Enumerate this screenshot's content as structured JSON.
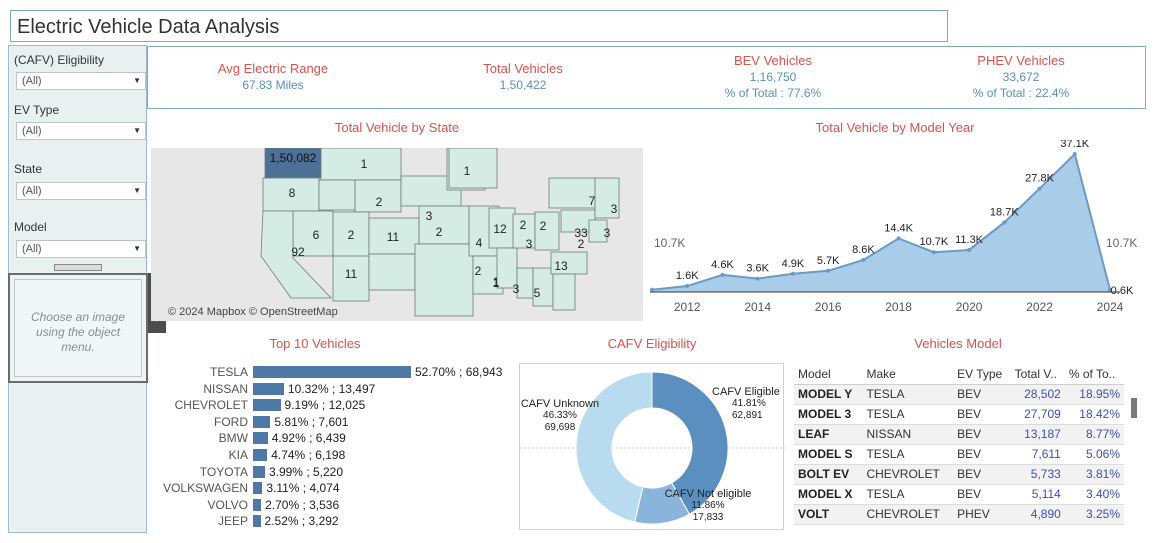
{
  "title": "Electric Vehicle Data Analysis",
  "filters": [
    {
      "label": "(CAFV) Eligibility",
      "value": "(All)"
    },
    {
      "label": "EV Type",
      "value": "(All)"
    },
    {
      "label": "State",
      "value": "(All)"
    },
    {
      "label": "Model",
      "value": "(All)"
    }
  ],
  "image_panel": {
    "message_line1": "Choose an image",
    "message_line2": "using the object",
    "message_line3": "menu."
  },
  "toolbar_icons": [
    "close-icon",
    "pin-icon",
    "caret-down-icon"
  ],
  "kpis": {
    "avg_range": {
      "title": "Avg Electric Range",
      "value": "67.83 Miles"
    },
    "total": {
      "title": "Total Vehicles",
      "value": "1,50,422"
    },
    "bev": {
      "title": "BEV Vehicles",
      "value": "1,16,750",
      "pct": "% of Total : 77.6%"
    },
    "phev": {
      "title": "PHEV Vehicles",
      "value": "33,672",
      "pct": "% of Total : 22.4%"
    }
  },
  "sections": {
    "map_title": "Total Vehicle by State",
    "year_title": "Total Vehicle by Model Year",
    "top10_title": "Top 10  Vehicles",
    "cafv_title": "CAFV Eligibility",
    "models_title": "Vehicles Model"
  },
  "map": {
    "credit": "© 2024 Mapbox © OpenStreetMap",
    "labels": [
      "1,50,082",
      "1",
      "8",
      "2",
      "1",
      "6",
      "92",
      "2",
      "11",
      "3",
      "2",
      "12",
      "2",
      "4",
      "3",
      "2",
      "7",
      "3",
      "33",
      "2",
      "1",
      "11",
      "2",
      "13",
      "3",
      "1",
      "3",
      "5"
    ]
  },
  "colors": {
    "accent_red": "#d9534f",
    "bar_blue": "#4e79a7",
    "area_blue": "#a9cde8",
    "line_blue": "#6b9ac4",
    "donut_dark": "#5b8fc0",
    "donut_mid": "#8ab4d9",
    "donut_light": "#b8dbf0",
    "map_fill": "#d4ece4",
    "map_wa": "#4e6f96"
  },
  "chart_data": [
    {
      "type": "area",
      "title": "Total Vehicle by Model Year",
      "x": [
        2011,
        2012,
        2013,
        2014,
        2015,
        2016,
        2017,
        2018,
        2019,
        2020,
        2021,
        2022,
        2023,
        2024
      ],
      "values": [
        0.6,
        1.6,
        4.6,
        3.6,
        4.9,
        5.7,
        8.6,
        14.4,
        10.7,
        11.3,
        18.7,
        27.8,
        37.1,
        0.6
      ],
      "point_labels": [
        "",
        "1.6K",
        "4.6K",
        "3.6K",
        "4.9K",
        "5.7K",
        "8.6K",
        "14.4K",
        "10.7K",
        "11.3K",
        "18.7K",
        "27.8K",
        "37.1K",
        "0.6K"
      ],
      "xticks": [
        "2012",
        "2014",
        "2016",
        "2018",
        "2020",
        "2022",
        "2024"
      ],
      "ref_label_left": "10.7K",
      "ref_label_right": "10.7K",
      "unit": "K"
    },
    {
      "type": "bar",
      "title": "Top 10  Vehicles",
      "categories": [
        "TESLA",
        "NISSAN",
        "CHEVROLET",
        "FORD",
        "BMW",
        "KIA",
        "TOYOTA",
        "VOLKSWAGEN",
        "VOLVO",
        "JEEP"
      ],
      "values": [
        68943,
        13497,
        12025,
        7601,
        6439,
        6198,
        5220,
        4074,
        3536,
        3292
      ],
      "labels": [
        "52.70% ; 68,943",
        "10.32% ; 13,497",
        "9.19% ; 12,025",
        "5.81% ; 7,601",
        "4.92% ; 6,439",
        "4.74% ; 6,198",
        "3.99% ; 5,220",
        "3.11% ; 4,074",
        "2.70% ; 3,536",
        "2.52% ; 3,292"
      ]
    },
    {
      "type": "pie",
      "title": "CAFV Eligibility",
      "categories": [
        "CAFV  Eligible",
        "CAFV Not eligible",
        "CAFV Unknown"
      ],
      "values": [
        62891,
        17833,
        69698
      ],
      "percents": [
        "41.81%",
        "11.86%",
        "46.33%"
      ],
      "counts": [
        "62,891",
        "17,833",
        "69,698"
      ]
    },
    {
      "type": "table",
      "title": "Vehicles Model",
      "columns": [
        "Model",
        "Make",
        "EV Type",
        "Total V..",
        "% of To.."
      ],
      "rows": [
        [
          "MODEL Y",
          "TESLA",
          "BEV",
          "28,502",
          "18.95%"
        ],
        [
          "MODEL 3",
          "TESLA",
          "BEV",
          "27,709",
          "18.42%"
        ],
        [
          "LEAF",
          "NISSAN",
          "BEV",
          "13,187",
          "8.77%"
        ],
        [
          "MODEL S",
          "TESLA",
          "BEV",
          "7,611",
          "5.06%"
        ],
        [
          "BOLT EV",
          "CHEVROLET",
          "BEV",
          "5,733",
          "3.81%"
        ],
        [
          "MODEL X",
          "TESLA",
          "BEV",
          "5,114",
          "3.40%"
        ],
        [
          "VOLT",
          "CHEVROLET",
          "PHEV",
          "4,890",
          "3.25%"
        ]
      ]
    }
  ]
}
